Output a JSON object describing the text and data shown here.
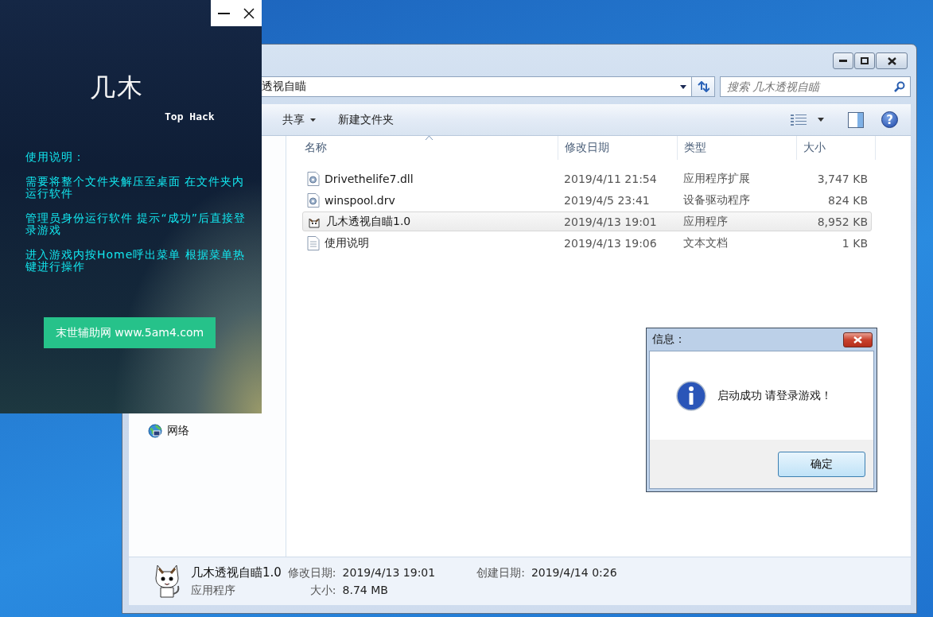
{
  "explorer": {
    "address": "透视自瞄",
    "search": {
      "placeholder": "搜索 几木透视自瞄"
    },
    "toolbar": [
      {
        "label": "共享",
        "kind": "menu"
      },
      {
        "label": "新建文件夹",
        "kind": "plain"
      }
    ],
    "help": "?",
    "nav_items": [
      {
        "label": "网络",
        "kind": "network"
      }
    ],
    "columns": [
      "名称",
      "修改日期",
      "类型",
      "大小"
    ],
    "files": [
      {
        "name": "Drivethelife7.dll",
        "modified": "2019/4/11 21:54",
        "type": "应用程序扩展",
        "size": "3,747 KB",
        "kind": "system",
        "selected": false
      },
      {
        "name": "winspool.drv",
        "modified": "2019/4/5 23:41",
        "type": "设备驱动程序",
        "size": "824 KB",
        "kind": "system",
        "selected": false
      },
      {
        "name": "几木透视自瞄1.0",
        "modified": "2019/4/13 19:01",
        "type": "应用程序",
        "size": "8,952 KB",
        "kind": "app",
        "selected": true
      },
      {
        "name": "使用说明",
        "modified": "2019/4/13 19:06",
        "type": "文本文档",
        "size": "1 KB",
        "kind": "text",
        "selected": false
      }
    ],
    "details": {
      "name": "几木透视自瞄1.0",
      "type": "应用程序",
      "fields": [
        {
          "label": "修改日期:",
          "value": "2019/4/13 19:01"
        },
        {
          "label": "创建日期:",
          "value": "2019/4/14 0:26"
        },
        {
          "label": "大小:",
          "value": "8.74 MB"
        }
      ]
    }
  },
  "launcher": {
    "title": "几木",
    "subtitle": "Top Hack",
    "heading": "使用说明：",
    "instructions": [
      "需要将整个文件夹解压至桌面 在文件夹内运行软件",
      "管理员身份运行软件 提示“成功”后直接登录游戏",
      "进入游戏内按Home呼出菜单 根据菜单热键进行操作"
    ],
    "link_button": "末世辅助网 www.5am4.com"
  },
  "dialog": {
    "title": "信息：",
    "message": "启动成功 请登录游戏！",
    "button": "确定"
  }
}
